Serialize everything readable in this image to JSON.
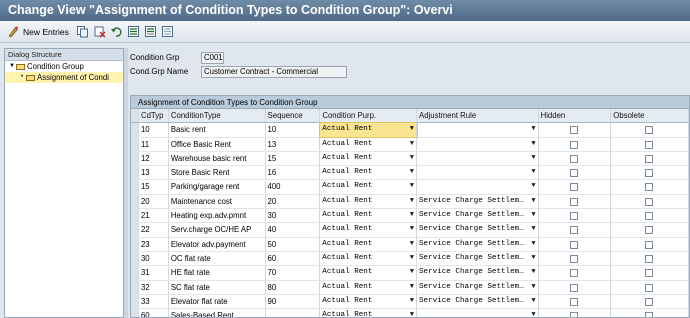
{
  "window": {
    "title": "Change View \"Assignment of Condition Types to Condition Group\": Overvi"
  },
  "toolbar": {
    "new_entries_label": "New Entries"
  },
  "dialog_structure": {
    "header": "Dialog Structure",
    "items": [
      {
        "label": "Condition Group"
      },
      {
        "label": "Assignment of Condi"
      }
    ]
  },
  "form": {
    "condition_grp_label": "Condition Grp",
    "condition_grp_value": "C001",
    "cond_grp_name_label": "Cond.Grp Name",
    "cond_grp_name_value": "Customer Contract - Commercial"
  },
  "table": {
    "title": "Assignment of Condition Types to Condition Group",
    "headers": {
      "cdtyp": "CdTyp",
      "condition_type": "ConditionType",
      "sequence": "Sequence",
      "condition_purp": "Condition Purp.",
      "adjustment_rule": "Adjustment Rule",
      "hidden": "Hidden",
      "obsolete": "Obsolete"
    },
    "rows": [
      {
        "cdtyp": "10",
        "condition_type": "Basic rent",
        "sequence": "10",
        "condition_purp": "Actual Rent",
        "adjustment_rule": ""
      },
      {
        "cdtyp": "11",
        "condition_type": "Office Basic Rent",
        "sequence": "13",
        "condition_purp": "Actual Rent",
        "adjustment_rule": ""
      },
      {
        "cdtyp": "12",
        "condition_type": "Warehouse basic rent",
        "sequence": "15",
        "condition_purp": "Actual Rent",
        "adjustment_rule": ""
      },
      {
        "cdtyp": "13",
        "condition_type": "Store Basic Rent",
        "sequence": "16",
        "condition_purp": "Actual Rent",
        "adjustment_rule": ""
      },
      {
        "cdtyp": "15",
        "condition_type": "Parking/garage rent",
        "sequence": "400",
        "condition_purp": "Actual Rent",
        "adjustment_rule": ""
      },
      {
        "cdtyp": "20",
        "condition_type": "Maintenance cost",
        "sequence": "20",
        "condition_purp": "Actual Rent",
        "adjustment_rule": "Service Charge Settlem…"
      },
      {
        "cdtyp": "21",
        "condition_type": "Heating exp.adv.pmnt",
        "sequence": "30",
        "condition_purp": "Actual Rent",
        "adjustment_rule": "Service Charge Settlem…"
      },
      {
        "cdtyp": "22",
        "condition_type": "Serv.charge OC/HE AP",
        "sequence": "40",
        "condition_purp": "Actual Rent",
        "adjustment_rule": "Service Charge Settlem…"
      },
      {
        "cdtyp": "23",
        "condition_type": "Elevator adv.payment",
        "sequence": "50",
        "condition_purp": "Actual Rent",
        "adjustment_rule": "Service Charge Settlem…"
      },
      {
        "cdtyp": "30",
        "condition_type": "OC flat rate",
        "sequence": "60",
        "condition_purp": "Actual Rent",
        "adjustment_rule": "Service Charge Settlem…"
      },
      {
        "cdtyp": "31",
        "condition_type": "HE flat rate",
        "sequence": "70",
        "condition_purp": "Actual Rent",
        "adjustment_rule": "Service Charge Settlem…"
      },
      {
        "cdtyp": "32",
        "condition_type": "SC flat rate",
        "sequence": "80",
        "condition_purp": "Actual Rent",
        "adjustment_rule": "Service Charge Settlem…"
      },
      {
        "cdtyp": "33",
        "condition_type": "Elevator flat rate",
        "sequence": "90",
        "condition_purp": "Actual Rent",
        "adjustment_rule": "Service Charge Settlem…"
      },
      {
        "cdtyp": "60",
        "condition_type": "Sales-Based Rent",
        "sequence": "",
        "condition_purp": "Actual Rent",
        "adjustment_rule": ""
      }
    ]
  },
  "colors": {
    "title_bar": "#4e6a86",
    "active_cell": "#f9e592",
    "table_header": "#b9cadb"
  }
}
